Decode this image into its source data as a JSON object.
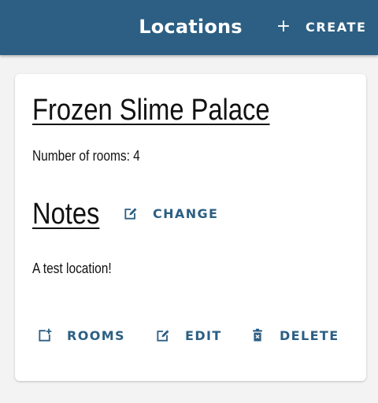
{
  "appbar": {
    "title": "Locations",
    "create_icon": "plus-icon",
    "create_label": "CREATE",
    "background_color": "#2c5f83"
  },
  "location": {
    "name": "Frozen Slime Palace",
    "rooms_text": "Number of rooms: 4",
    "notes_heading": "Notes",
    "change_icon": "edit-icon",
    "change_label": "CHANGE",
    "notes_text": "A test location!"
  },
  "actions": {
    "rooms_icon": "add-box-icon",
    "rooms_label": "ROOMS",
    "edit_icon": "edit-icon",
    "edit_label": "EDIT",
    "delete_icon": "trash-icon",
    "delete_label": "DELETE",
    "accent_color": "#2c5f83"
  }
}
